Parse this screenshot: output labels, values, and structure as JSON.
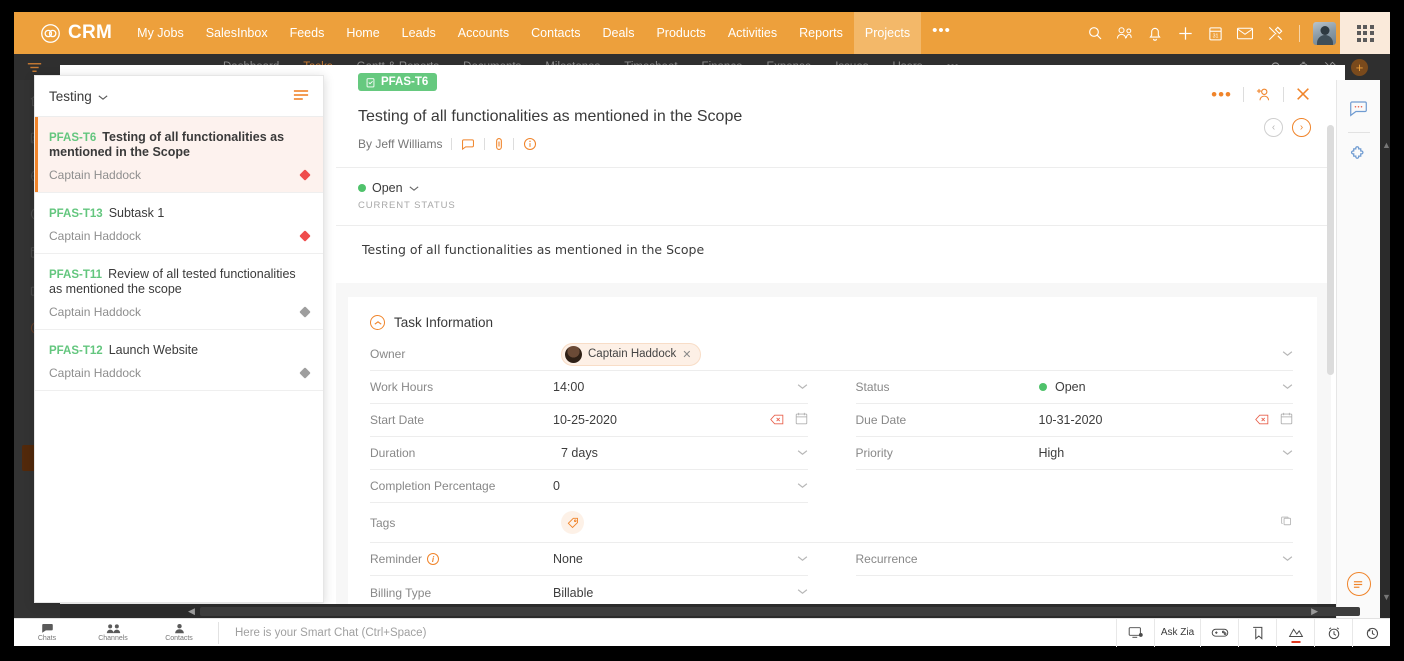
{
  "topnav": {
    "brand": "CRM",
    "items": [
      {
        "label": "My Jobs",
        "active": false
      },
      {
        "label": "SalesInbox",
        "active": false
      },
      {
        "label": "Feeds",
        "active": false
      },
      {
        "label": "Home",
        "active": false
      },
      {
        "label": "Leads",
        "active": false
      },
      {
        "label": "Accounts",
        "active": false
      },
      {
        "label": "Contacts",
        "active": false
      },
      {
        "label": "Deals",
        "active": false
      },
      {
        "label": "Products",
        "active": false
      },
      {
        "label": "Activities",
        "active": false
      },
      {
        "label": "Reports",
        "active": false
      },
      {
        "label": "Projects",
        "active": true
      }
    ],
    "more_label": "•••",
    "icons": [
      "search-icon",
      "users-icon",
      "bell-icon",
      "plus-icon",
      "calendar-icon",
      "envelope-icon",
      "tools-icon"
    ],
    "accent": "#eda03c",
    "active_bg": "#f3b869"
  },
  "subnav": {
    "items": [
      {
        "label": "Dashboard",
        "active": false
      },
      {
        "label": "Tasks",
        "active": true
      },
      {
        "label": "Gantt & Reports",
        "active": false
      },
      {
        "label": "Documents",
        "active": false
      },
      {
        "label": "Milestones",
        "active": false
      },
      {
        "label": "Timesheet",
        "active": false
      },
      {
        "label": "Finance",
        "active": false
      },
      {
        "label": "Expense",
        "active": false
      },
      {
        "label": "Issues",
        "active": false
      },
      {
        "label": "Users",
        "active": false
      }
    ],
    "more_label": "•••",
    "plus_label": "+"
  },
  "leftrail": {
    "section_label": "R"
  },
  "listpanel": {
    "title": "Testing",
    "items": [
      {
        "code": "PFAS-T6",
        "name": "Testing of all functionalities as mentioned in the Scope",
        "owner": "Captain Haddock",
        "priority_color": "#ef4c4c",
        "selected": true
      },
      {
        "code": "PFAS-T13",
        "name": "Subtask 1",
        "owner": "Captain Haddock",
        "priority_color": "#ef4c4c",
        "selected": false
      },
      {
        "code": "PFAS-T11",
        "name": "Review of all tested functionalities as mentioned the scope",
        "owner": "Captain Haddock",
        "priority_color": "#9e9e9e",
        "selected": false
      },
      {
        "code": "PFAS-T12",
        "name": "Launch Website",
        "owner": "Captain Haddock",
        "priority_color": "#9e9e9e",
        "selected": false
      }
    ]
  },
  "detail": {
    "badge": "PFAS-T6",
    "title": "Testing of all functionalities as mentioned in the Scope",
    "byline": "By Jeff Williams",
    "actions": {
      "more_label": "•••",
      "add_user": "add-user-icon",
      "close": "✕",
      "prev": "‹",
      "next": "›"
    },
    "status": {
      "value": "Open",
      "caption": "CURRENT STATUS",
      "color": "#4fc26b"
    },
    "description": "Testing of all functionalities as mentioned in the Scope",
    "section_title": "Task Information",
    "fields": {
      "owner_label": "Owner",
      "owner_value": "Captain Haddock",
      "owner_remove": "✕",
      "work_hours_label": "Work Hours",
      "work_hours_value": "14:00",
      "status_label": "Status",
      "status_value": "Open",
      "start_date_label": "Start Date",
      "start_date_value": "10-25-2020",
      "due_date_label": "Due Date",
      "due_date_value": "10-31-2020",
      "duration_label": "Duration",
      "duration_value": "7  days",
      "priority_label": "Priority",
      "priority_value": "High",
      "completion_label": "Completion Percentage",
      "completion_value": "0",
      "tags_label": "Tags",
      "reminder_label": "Reminder",
      "reminder_value": "None",
      "recurrence_label": "Recurrence",
      "billing_label": "Billing Type",
      "billing_value": "Billable"
    }
  },
  "bottombar": {
    "tabs": [
      {
        "label": "Chats",
        "icon": "chat-bubble-icon"
      },
      {
        "label": "Channels",
        "icon": "channels-icon"
      },
      {
        "label": "Contacts",
        "icon": "contact-person-icon"
      }
    ],
    "placeholder": "Here is your Smart Chat (Ctrl+Space)",
    "ask_zia": "Ask Zia"
  }
}
